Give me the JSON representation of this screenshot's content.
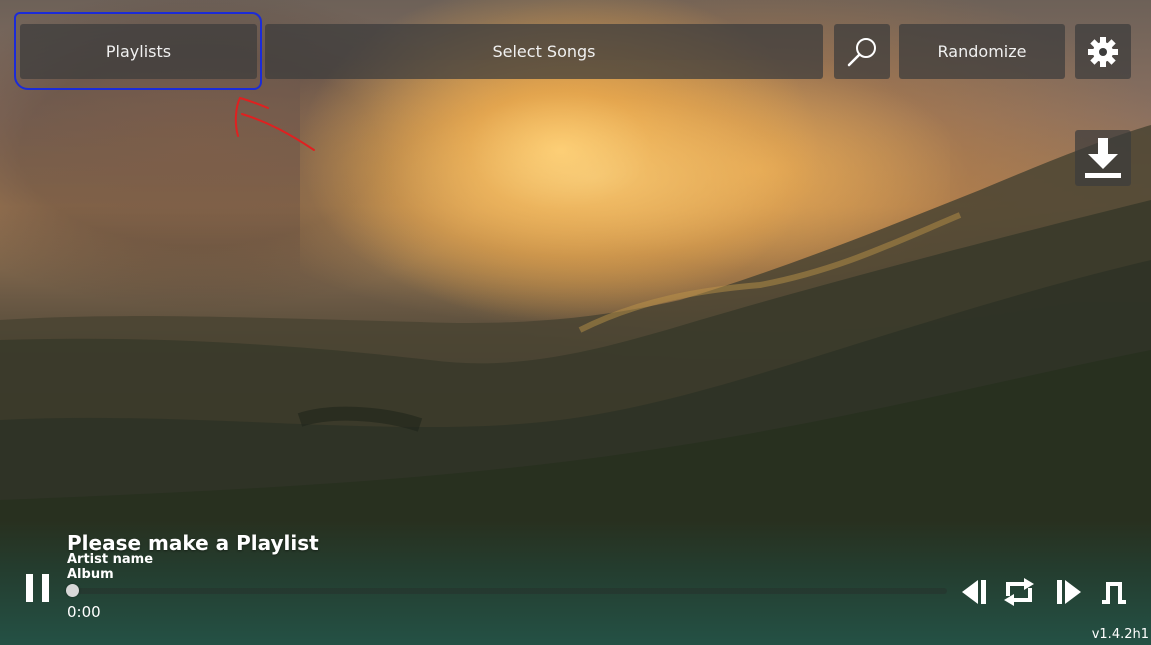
{
  "toolbar": {
    "playlists_label": "Playlists",
    "select_songs_label": "Select Songs",
    "randomize_label": "Randomize"
  },
  "icons": {
    "search": "search-icon",
    "settings": "gear-icon",
    "download": "download-icon",
    "pause": "pause-icon",
    "previous": "skip-previous-icon",
    "loop": "repeat-icon",
    "next": "skip-next-icon",
    "mode": "playback-mode-icon"
  },
  "now_playing": {
    "title": "Please make a Playlist",
    "artist": "Artist name",
    "album": "Album",
    "current_time": "0:00",
    "progress": 0.0
  },
  "footer": {
    "version": "v1.4.2h1"
  },
  "colors": {
    "annotation_outline": "#1b2bd8",
    "annotation_arrow": "#e02020",
    "button_bg": "rgba(60,60,60,0.72)"
  }
}
